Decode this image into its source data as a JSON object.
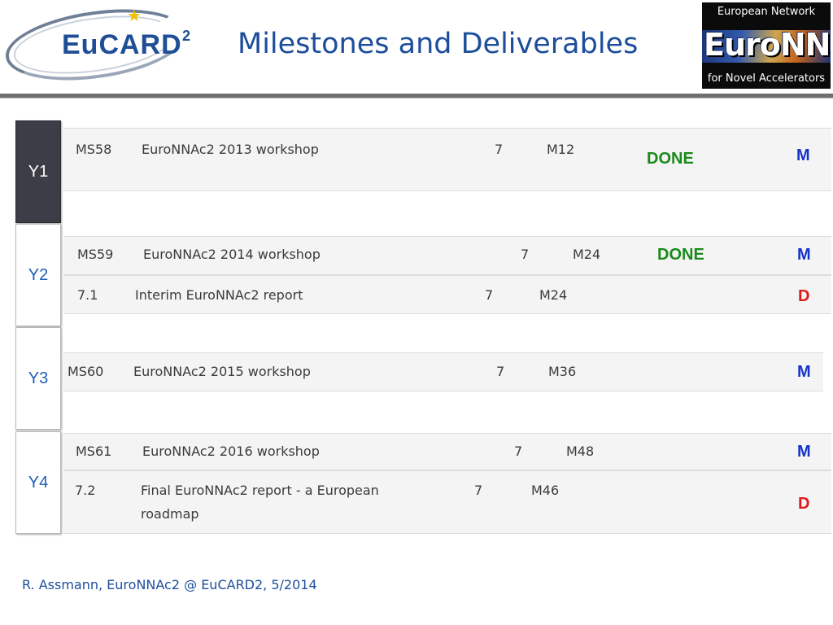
{
  "header": {
    "title": "Milestones and Deliverables",
    "logo_left": {
      "text": "EuCARD",
      "superscript": "2"
    },
    "logo_right": {
      "top_text": "European Network",
      "main_text": "EuroNNAc",
      "bottom_text": "for Novel Accelerators"
    }
  },
  "years": [
    "Y1",
    "Y2",
    "Y3",
    "Y4"
  ],
  "active_year": "Y1",
  "rows": [
    {
      "id": "MS58",
      "description": "EuroNNAc2 2013 workshop",
      "wp": "7",
      "month": "M12",
      "status": "DONE",
      "type": "M"
    },
    {
      "id": "MS59",
      "description": "EuroNNAc2 2014 workshop",
      "wp": "7",
      "month": "M24",
      "status": "DONE",
      "type": "M"
    },
    {
      "id": "7.1",
      "description": "Interim EuroNNAc2 report",
      "wp": "7",
      "month": "M24",
      "status": "",
      "type": "D"
    },
    {
      "id": "MS60",
      "description": "EuroNNAc2 2015 workshop",
      "wp": "7",
      "month": "M36",
      "status": "",
      "type": "M"
    },
    {
      "id": "MS61",
      "description": "EuroNNAc2 2016 workshop",
      "wp": "7",
      "month": "M48",
      "status": "",
      "type": "M"
    },
    {
      "id": "7.2",
      "description_line1": "Final EuroNNAc2 report - a European",
      "description_line2": "roadmap",
      "wp": "7",
      "month": "M46",
      "status": "",
      "type": "D"
    }
  ],
  "colors": {
    "title": "#1d4e9c",
    "done": "#1a8a1a",
    "milestone": "#1533c8",
    "deliverable": "#e01a1a",
    "active_tab": "#3d3d47"
  },
  "footer": "R. Assmann, EuroNNAc2 @ EuCARD2, 5/2014"
}
